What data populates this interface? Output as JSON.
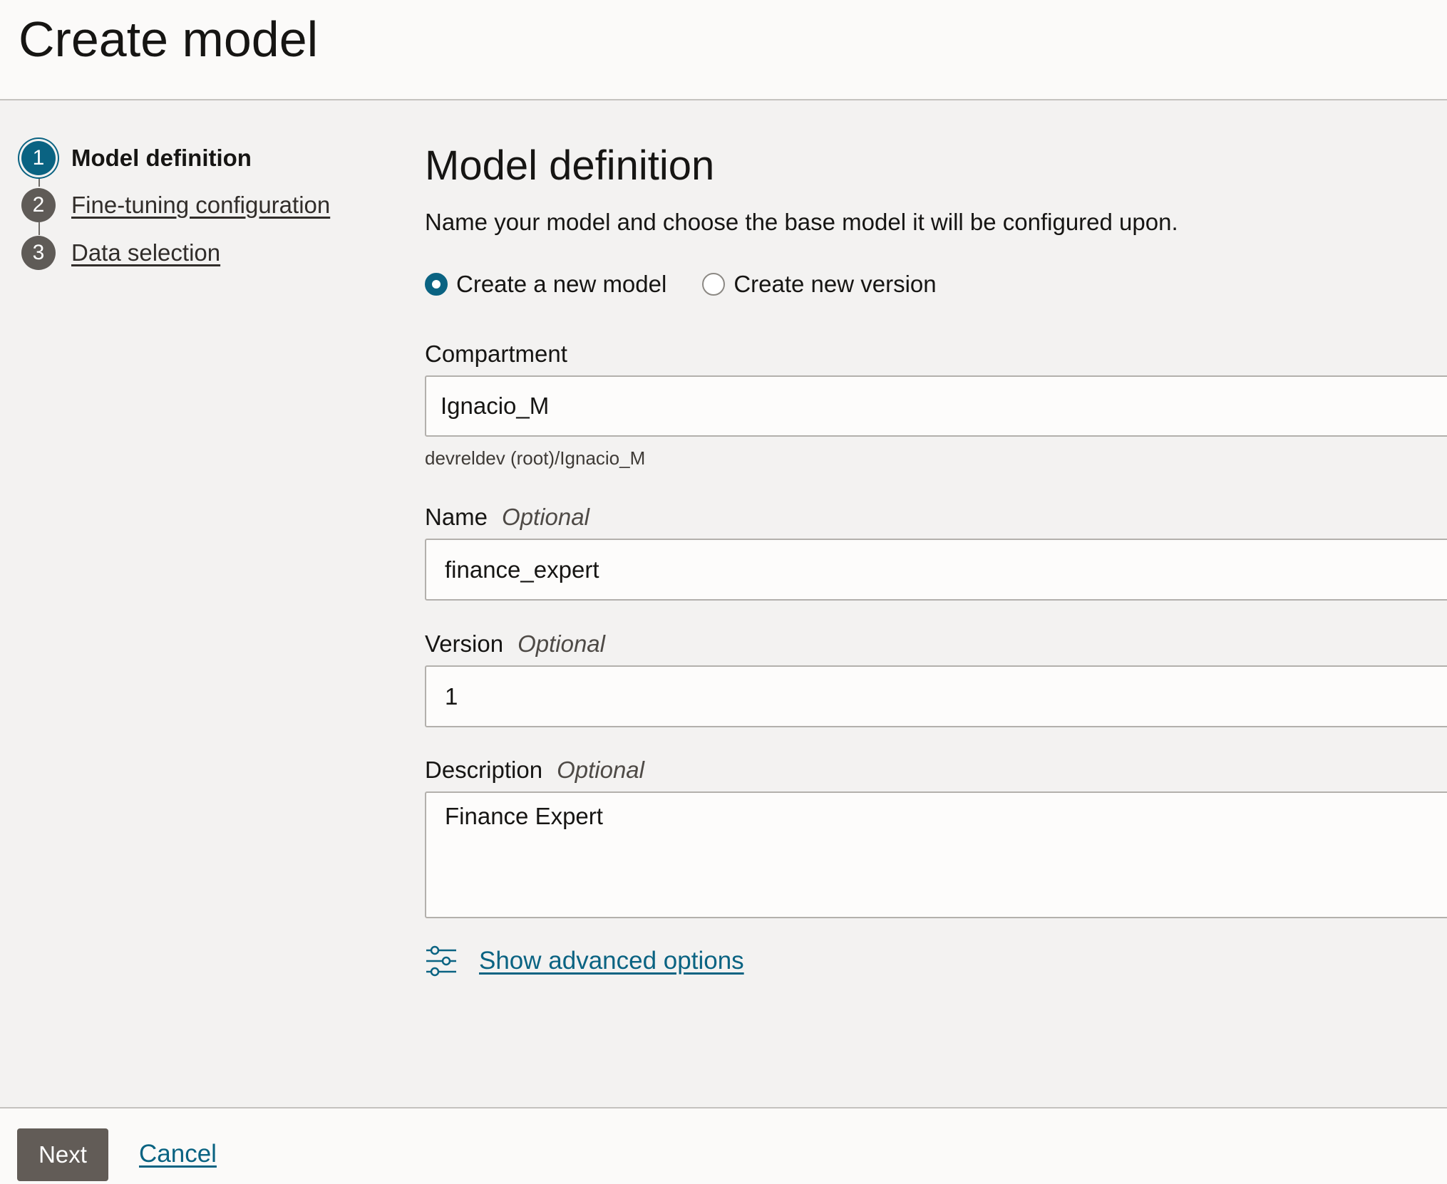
{
  "header": {
    "title": "Create model"
  },
  "steps": [
    {
      "number": "1",
      "label": "Model definition",
      "active": true
    },
    {
      "number": "2",
      "label": "Fine-tuning configuration",
      "active": false
    },
    {
      "number": "3",
      "label": "Data selection",
      "active": false
    }
  ],
  "form": {
    "title": "Model definition",
    "description": "Name your model and choose the base model it will be configured upon.",
    "radio_options": [
      {
        "label": "Create a new model",
        "checked": true
      },
      {
        "label": "Create new version",
        "checked": false
      }
    ],
    "compartment": {
      "label": "Compartment",
      "value": "Ignacio_M",
      "helper": "devreldev (root)/Ignacio_M"
    },
    "name": {
      "label": "Name",
      "optional": "Optional",
      "value": "finance_expert"
    },
    "version": {
      "label": "Version",
      "optional": "Optional",
      "value": "1"
    },
    "description_field": {
      "label": "Description",
      "optional": "Optional",
      "value": "Finance Expert"
    },
    "advanced_options": {
      "icon": "sliders-icon",
      "label": "Show advanced options"
    }
  },
  "footer": {
    "next_label": "Next",
    "cancel_label": "Cancel"
  },
  "colors": {
    "accent": "#0a6382",
    "background": "#f3f2f1",
    "button": "#625c57"
  }
}
